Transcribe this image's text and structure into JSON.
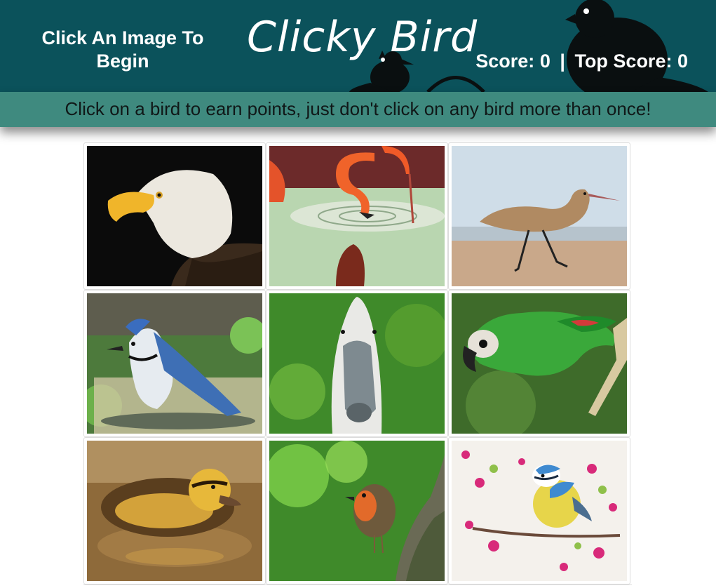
{
  "header": {
    "status_message": "Click An Image To Begin",
    "title": "Clicky Bird",
    "score_label": "Score:",
    "score_value": "0",
    "separator": "|",
    "top_score_label": "Top Score:",
    "top_score_value": "0",
    "background_color": "#0b525b"
  },
  "tagline": {
    "text": "Click on a bird to earn points, just don't click on any bird more than once!",
    "background_color": "#3f8a7f"
  },
  "birds": [
    {
      "subject": "bald-eagle"
    },
    {
      "subject": "flamingo"
    },
    {
      "subject": "godwit"
    },
    {
      "subject": "blue-jay"
    },
    {
      "subject": "goose"
    },
    {
      "subject": "macaw"
    },
    {
      "subject": "duckling"
    },
    {
      "subject": "robin"
    },
    {
      "subject": "blue-tit"
    }
  ]
}
